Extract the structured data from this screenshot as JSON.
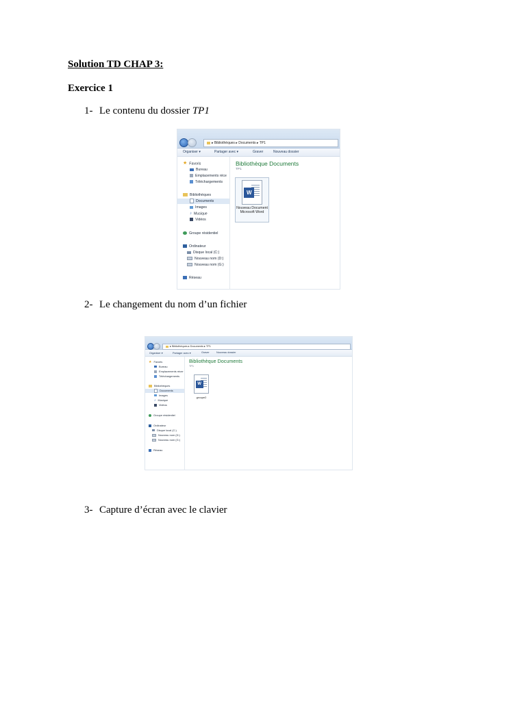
{
  "document": {
    "title": "Solution TD CHAP 3:",
    "section": "Exercice 1",
    "items": [
      {
        "num": "1-",
        "text": "Le contenu du dossier ",
        "emph": "TP1"
      },
      {
        "num": "2-",
        "text": "Le changement du nom d’un fichier"
      },
      {
        "num": "3-",
        "text": "Capture d’écran avec le clavier"
      }
    ]
  },
  "explorer1": {
    "breadcrumb": "▸  Bibliothèques  ▸  Documents  ▸  TP1",
    "toolbar": [
      "Organiser ▾",
      "Partager avec ▾",
      "Graver",
      "Nouveau dossier"
    ],
    "nav": {
      "favoris": "Favoris",
      "bureau": "Bureau",
      "emplacements": "Emplacements réce",
      "telechargements": "Téléchargements",
      "bibliotheques": "Bibliothèques",
      "documents": "Documents",
      "images": "Images",
      "musique": "Musique",
      "videos": "Vidéos",
      "groupe": "Groupe résidentiel",
      "ordinateur": "Ordinateur",
      "disque_c": "Disque local (C:)",
      "nouveau_d": "Nouveau nom (D:)",
      "nouveau_g": "Nouveau nom (G:)",
      "reseau": "Réseau"
    },
    "content_title": "Bibliothèque Documents",
    "content_sub": "TP1",
    "file": {
      "badge": "W",
      "name": "Nouveau Document Microsoft Word"
    }
  },
  "explorer2": {
    "breadcrumb": "▸  Bibliothèques  ▸  Documents  ▸  TP1",
    "toolbar": [
      "Organiser ▾",
      "Partager avec ▾",
      "Graver",
      "Nouveau dossier"
    ],
    "nav": {
      "favoris": "Favoris",
      "bureau": "Bureau",
      "emplacements": "Emplacements récer",
      "telechargements": "Téléchargements",
      "bibliotheques": "Bibliothèques",
      "documents": "Documents",
      "images": "Images",
      "musique": "Musique",
      "videos": "Vidéos",
      "groupe": "Groupe résidentiel",
      "ordinateur": "Ordinateur",
      "disque_c": "Disque local (C:)",
      "nouveau_d": "Nouveau nom (D:)",
      "nouveau_g": "Nouveau nom (G:)",
      "reseau": "Réseau"
    },
    "content_title": "Bibliothèque Documents",
    "content_sub": "TP1",
    "file": {
      "badge": "W",
      "name": "groupe2"
    }
  },
  "colors": {
    "accent": "#2b579a",
    "library_title": "#1f7a3a"
  }
}
